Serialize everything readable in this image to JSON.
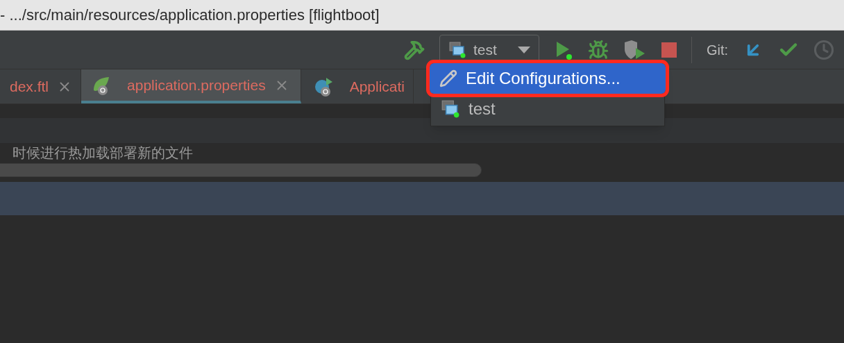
{
  "window": {
    "title": "- .../src/main/resources/application.properties [flightboot]"
  },
  "toolbar": {
    "run_config": "test",
    "git_label": "Git:"
  },
  "tabs": [
    {
      "label": "dex.ftl",
      "selected": false,
      "closable": true,
      "kind": "plain"
    },
    {
      "label": "application.properties",
      "selected": true,
      "closable": true,
      "kind": "spring"
    },
    {
      "label": "Applicati",
      "selected": false,
      "closable": false,
      "kind": "boot"
    }
  ],
  "dropdown": [
    {
      "label": "Edit Configurations...",
      "kind": "edit",
      "selected": true
    },
    {
      "label": "test",
      "kind": "config",
      "selected": false
    }
  ],
  "editor": {
    "comment": "时候进行热加载部署新的文件"
  }
}
